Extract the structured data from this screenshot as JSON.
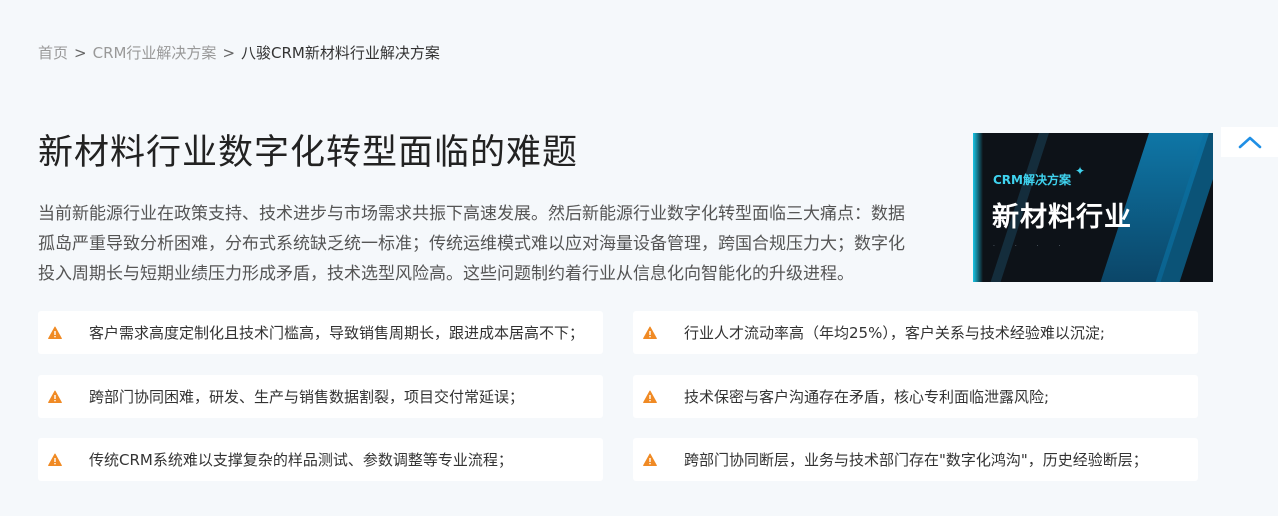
{
  "breadcrumb": {
    "home": "首页",
    "section": "CRM行业解决方案",
    "current": "八骏CRM新材料行业解决方案",
    "separator": ">"
  },
  "page_title": "新材料行业数字化转型面临的难题",
  "intro_lines": [
    "当前新能源行业在政策支持、技术进步与市场需求共振下高速发展。然后新能源行业数字化转型面临三大痛点：数据",
    "孤岛严重导致分析困难，分布式系统缺乏统一标准；传统运维模式难以应对海量设备管理，跨国合规压力大；数字化",
    "投入周期长与短期业绩压力形成矛盾，技术选型风险高。这些问题制约着行业从信息化向智能化的升级进程。"
  ],
  "hero": {
    "tag": "CRM解决方案",
    "title": "新材料行业",
    "dots": "· · · ·"
  },
  "pain_points": [
    "客户需求高度定制化且技术门槛高，导致销售周期长，跟进成本居高不下；",
    "行业人才流动率高（年均25%），客户关系与技术经验难以沉淀;",
    "跨部门协同困难，研发、生产与销售数据割裂，项目交付常延误；",
    "技术保密与客户沟通存在矛盾，核心专利面临泄露风险;",
    "传统CRM系统难以支撑复杂的样品测试、参数调整等专业流程；",
    "跨部门协同断层，业务与技术部门存在\"数字化鸿沟\"，历史经验断层；"
  ],
  "colors": {
    "warning": "#f08a24",
    "accent": "#1f8fe5",
    "background": "#f5f8fb"
  },
  "icons": {
    "warning": "warning-icon",
    "back_to_top": "chevron-up-icon"
  }
}
